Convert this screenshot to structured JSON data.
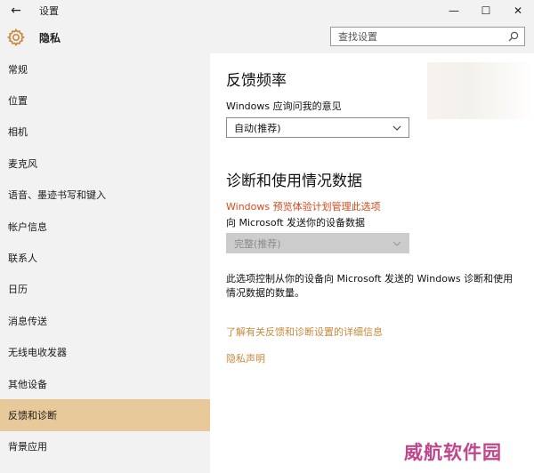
{
  "window": {
    "title": "设置",
    "back_icon": "←",
    "minimize_icon": "—",
    "maximize_icon": "☐",
    "close_icon": "✕"
  },
  "header": {
    "title": "隐私",
    "search_placeholder": "查找设置"
  },
  "sidebar": {
    "items": [
      {
        "label": "常规"
      },
      {
        "label": "位置"
      },
      {
        "label": "相机"
      },
      {
        "label": "麦克风"
      },
      {
        "label": "语音、墨迹书写和键入"
      },
      {
        "label": "帐户信息"
      },
      {
        "label": "联系人"
      },
      {
        "label": "日历"
      },
      {
        "label": "消息传送"
      },
      {
        "label": "无线电收发器"
      },
      {
        "label": "其他设备"
      },
      {
        "label": "反馈和诊断"
      },
      {
        "label": "背景应用"
      }
    ],
    "active_index": 11
  },
  "feedback": {
    "heading": "反馈频率",
    "label": "Windows 应询问我的意见",
    "select_value": "自动(推荐)"
  },
  "diagnostics": {
    "heading": "诊断和使用情况数据",
    "managed_notice": "Windows 预览体验计划管理此选项",
    "label": "向 Microsoft 发送你的设备数据",
    "select_value": "完整(推荐)",
    "description": "此选项控制从你的设备向 Microsoft 发送的 Windows 诊断和使用情况数据的数量。",
    "learn_more_link": "了解有关反馈和诊断设置的详细信息",
    "privacy_link": "隐私声明"
  },
  "watermark": "威航软件园",
  "colors": {
    "active_nav": "#e8c99a",
    "warning": "#d94a1a",
    "link": "#c88a3c",
    "watermark": "#c0458c"
  }
}
